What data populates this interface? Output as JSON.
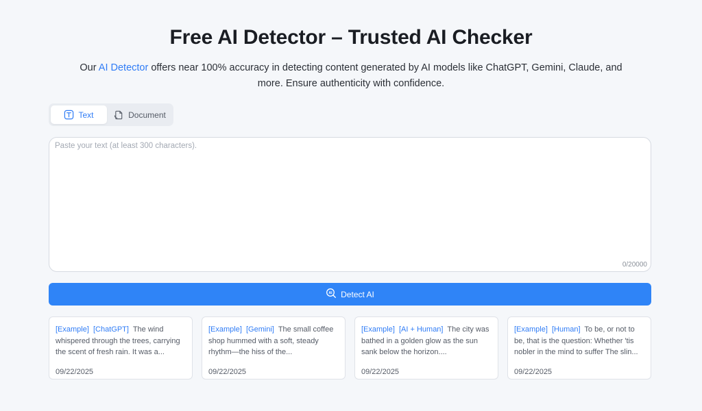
{
  "header": {
    "title": "Free AI Detector – Trusted AI Checker",
    "subtitle_prefix": "Our ",
    "subtitle_link": "AI Detector",
    "subtitle_rest": " offers near 100% accuracy in detecting content generated by AI models like ChatGPT, Gemini, Claude, and more. Ensure authenticity with confidence."
  },
  "tabs": [
    {
      "label": "Text",
      "icon": "text-icon",
      "active": true
    },
    {
      "label": "Document",
      "icon": "document-icon",
      "active": false
    }
  ],
  "editor": {
    "placeholder": "Paste your text (at least 300 characters).",
    "value": "",
    "counter": "0/20000"
  },
  "detect_button": {
    "label": "Detect AI",
    "icon": "ai-search-icon"
  },
  "examples": [
    {
      "tag1": "[Example]",
      "tag2": "[ChatGPT]",
      "snippet": "The wind whispered through the trees, carrying the scent of fresh rain. It was a...",
      "date": "09/22/2025"
    },
    {
      "tag1": "[Example]",
      "tag2": "[Gemini]",
      "snippet": "The small coffee shop hummed with a soft, steady rhythm—the hiss of the...",
      "date": "09/22/2025"
    },
    {
      "tag1": "[Example]",
      "tag2": "[AI + Human]",
      "snippet": "The city was bathed in a golden glow as the sun sank below the horizon....",
      "date": "09/22/2025"
    },
    {
      "tag1": "[Example]",
      "tag2": "[Human]",
      "snippet": "To be, or not to be, that is the question: Whether 'tis nobler in the mind to suffer The slin...",
      "date": "09/22/2025"
    }
  ],
  "colors": {
    "accent": "#2f84f7",
    "link": "#2f7cf6",
    "background": "#f5f7fa"
  }
}
